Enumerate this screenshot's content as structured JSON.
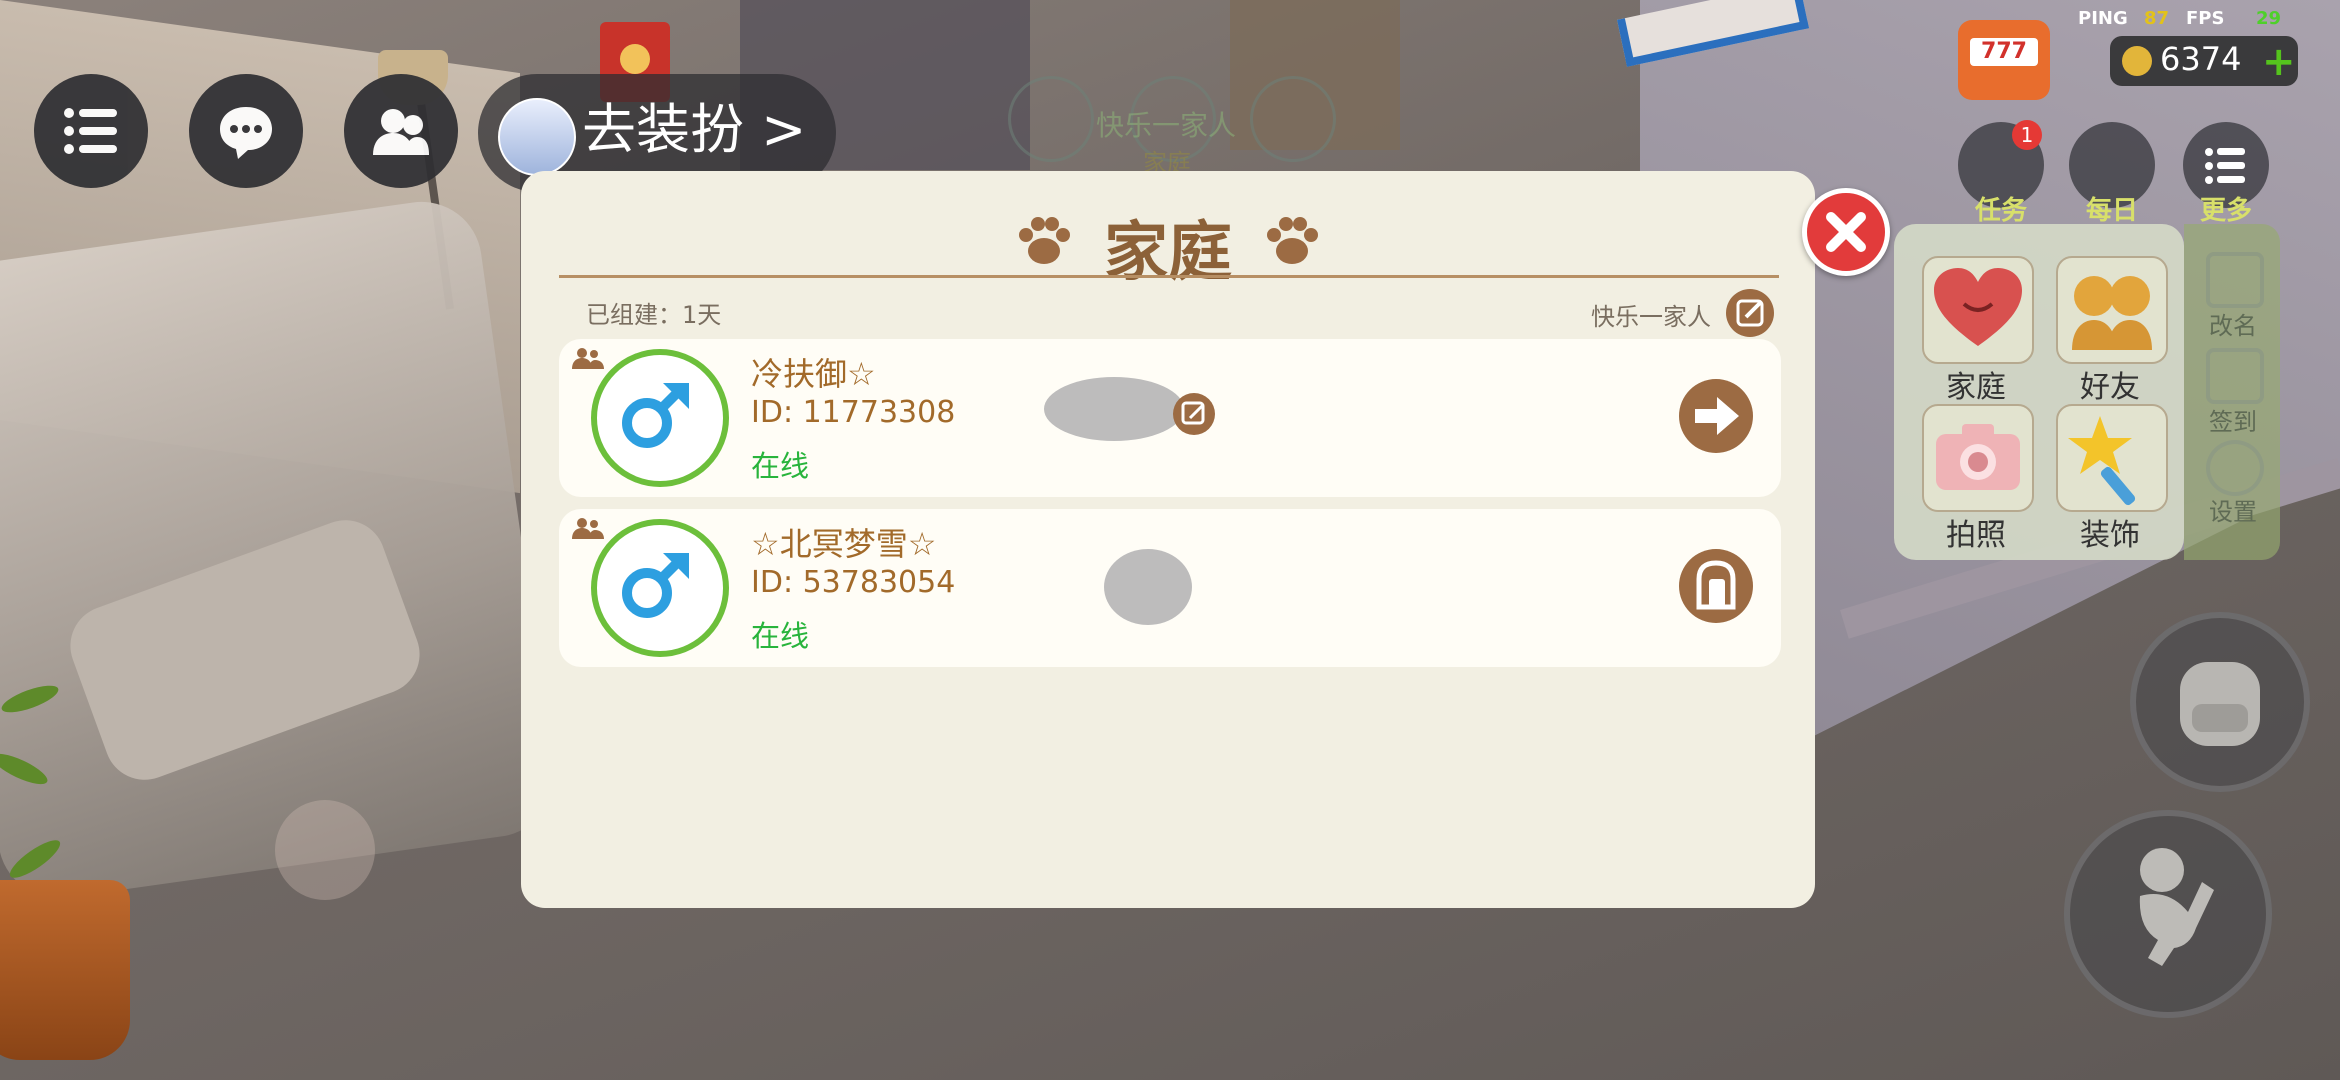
{
  "hud": {
    "outfit_label": "去装扮 >",
    "ping_label": "PING",
    "ping_value": "87",
    "fps_label": "FPS",
    "fps_value": "29",
    "coins": "6374",
    "slot_text": "777",
    "task_badge": "1",
    "top_buttons": [
      "任务",
      "每日",
      "更多"
    ],
    "faded_text": "快乐一家人",
    "faded_text2": "家庭"
  },
  "side_menu": {
    "tiles": [
      "家庭",
      "好友",
      "拍照",
      "装饰"
    ],
    "strip": [
      "改名",
      "签到",
      "设置"
    ]
  },
  "family": {
    "title": "家庭",
    "built": "已组建：1天",
    "family_name": "快乐一家人",
    "members": [
      {
        "name": "冷扶御☆",
        "id": "ID: 11773308",
        "status": "在线"
      },
      {
        "name": "☆北冥梦雪☆",
        "id": "ID: 53783054",
        "status": "在线"
      }
    ]
  },
  "colors": {
    "dialog_bg": "#f2efe2",
    "title_brown": "#8c6138",
    "online_green": "#28b43c",
    "gender_ring": "#6cbf3b",
    "close_red": "#e23b3b"
  }
}
